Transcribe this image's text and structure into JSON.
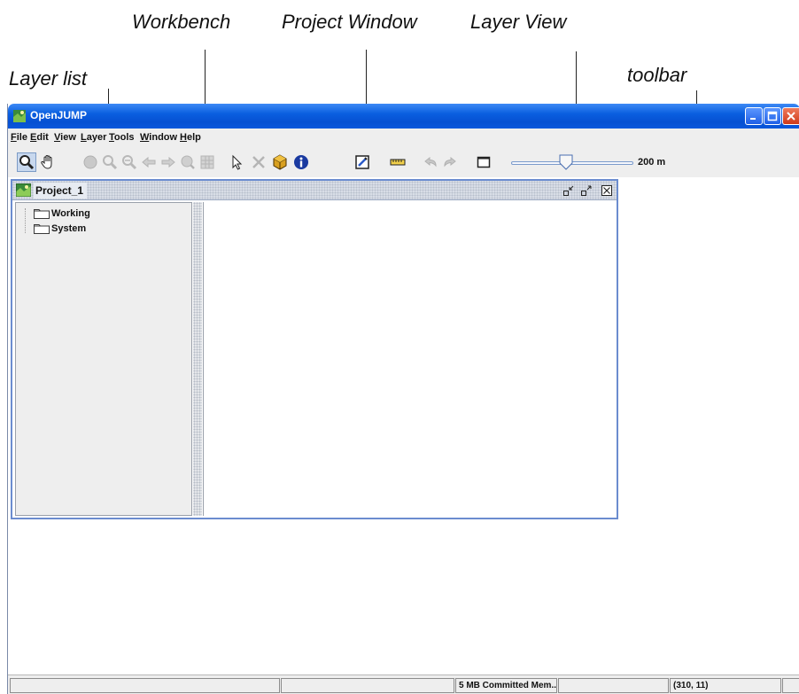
{
  "annotations": {
    "workbench": "Workbench",
    "project_window": "Project Window",
    "layer_view": "Layer View",
    "layer_list": "Layer list",
    "toolbar": "toolbar"
  },
  "window": {
    "title": "OpenJUMP",
    "title_color": "#0a5fe0"
  },
  "menu": {
    "items": [
      {
        "mnemonic": "F",
        "rest": "ile"
      },
      {
        "mnemonic": "E",
        "rest": "dit"
      },
      {
        "mnemonic": "V",
        "rest": "iew"
      },
      {
        "mnemonic": "L",
        "rest": "ayer"
      },
      {
        "mnemonic": "T",
        "rest": "ools"
      },
      {
        "mnemonic": "W",
        "rest": "indow"
      },
      {
        "mnemonic": "H",
        "rest": "elp"
      }
    ]
  },
  "toolbar": {
    "tools": [
      "zoom-icon",
      "pan-icon",
      "zoom-full-icon",
      "zoom-previous-icon",
      "zoom-next-icon",
      "zoom-back-icon",
      "zoom-forward-icon",
      "zoom-selected-icon",
      "zoom-grid-icon",
      "select-arrow-icon",
      "measure-delete-icon",
      "feature-box-icon",
      "info-icon",
      "edit-toolbox-icon",
      "ruler-icon",
      "undo-icon",
      "redo-icon",
      "frame-icon"
    ],
    "scale_label": "200 m",
    "scale_slider_value": 0.45
  },
  "project": {
    "title": "Project_1",
    "categories": [
      {
        "label": "Working"
      },
      {
        "label": "System"
      }
    ],
    "border_color": "#6b8ccf"
  },
  "statusbar": {
    "message": "",
    "field2": "",
    "memory": "5 MB Committed Mem...",
    "field4": "",
    "coordinates": "(310, 11)",
    "field6": ""
  }
}
